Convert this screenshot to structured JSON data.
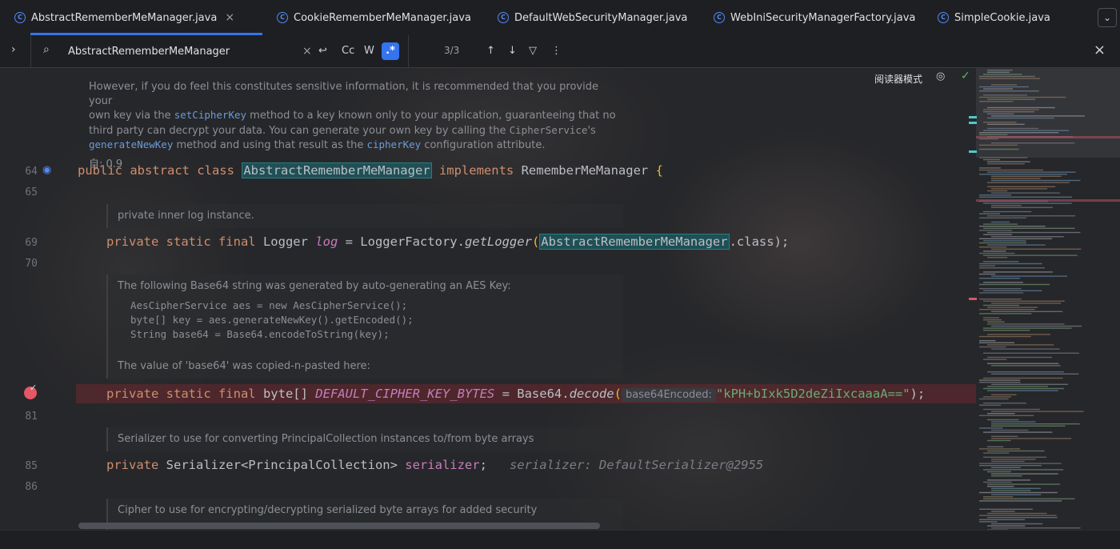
{
  "tabs": [
    {
      "label": "AbstractRememberMeManager.java",
      "active": true,
      "closable": true
    },
    {
      "label": "CookieRememberMeManager.java",
      "active": false,
      "closable": false
    },
    {
      "label": "DefaultWebSecurityManager.java",
      "active": false,
      "closable": false
    },
    {
      "label": "WebIniSecurityManagerFactory.java",
      "active": false,
      "closable": false
    },
    {
      "label": "SimpleCookie.java",
      "active": false,
      "closable": false
    }
  ],
  "search": {
    "query": "AbstractRememberMeManager",
    "match_case_label": "Cc",
    "words_label": "W",
    "regex_label": ".*",
    "count": "3/3"
  },
  "reader_mode_label": "阅读器模式",
  "doc_top": {
    "line1": "However, if you do feel this constitutes sensitive information, it is recommended that you provide your",
    "line2_pre": "own key via the ",
    "line2_link": "setCipherKey",
    "line2_post": " method to a key known only to your application, guaranteeing that no",
    "line3_pre": "third party can decrypt your data. You can generate your own key by calling the ",
    "line3_code": "CipherService",
    "line3_post": "'s",
    "line4_link": "generateNewKey",
    "line4_mid": " method and using that result as the ",
    "line4_link2": "cipherKey",
    "line4_post": " configuration attribute.",
    "since": "自: 0.9"
  },
  "line_numbers": {
    "l64": "64",
    "l65": "65",
    "l69": "69",
    "l70": "70",
    "l81": "81",
    "l85": "85",
    "l86": "86"
  },
  "code": {
    "class_decl": {
      "kw": "public abstract class ",
      "name": "AbstractRememberMeManager",
      "impl": " implements ",
      "iface": "RememberMeManager ",
      "brace": "{"
    },
    "log_line": {
      "kw": "private static final ",
      "type": "Logger ",
      "field": "log",
      "eq": " = LoggerFactory.",
      "fn": "getLogger",
      "paren": "(",
      "arg": "AbstractRememberMeManager",
      "tail": ".class);"
    },
    "key_line": {
      "kw": "private static final ",
      "type": "byte[] ",
      "const": "DEFAULT_CIPHER_KEY_BYTES",
      "eq": " = Base64.",
      "fn": "decode",
      "paren": "(",
      "hint": "base64Encoded:",
      "str": "\"kPH+bIxk5D2deZiIxcaaaA==\"",
      "tail": ");"
    },
    "ser_line": {
      "kw": "private ",
      "type": "Serializer<PrincipalCollection> ",
      "field": "serializer",
      "semi": ";",
      "inline": "serializer: DefaultSerializer@2955"
    }
  },
  "docs": {
    "log_doc": "private inner log instance.",
    "b64_doc1": "The following Base64 string was generated by auto-generating an AES Key:",
    "b64_code1": "AesCipherService aes = new AesCipherService();",
    "b64_code2": "byte[] key = aes.generateNewKey().getEncoded();",
    "b64_code3": "String base64 = Base64.encodeToString(key);",
    "b64_doc2": "The value of 'base64' was copied-n-pasted here:",
    "ser_doc": "Serializer to use for converting PrincipalCollection instances to/from byte arrays",
    "cipher_doc": "Cipher to use for encrypting/decrypting serialized byte arrays for added security"
  }
}
